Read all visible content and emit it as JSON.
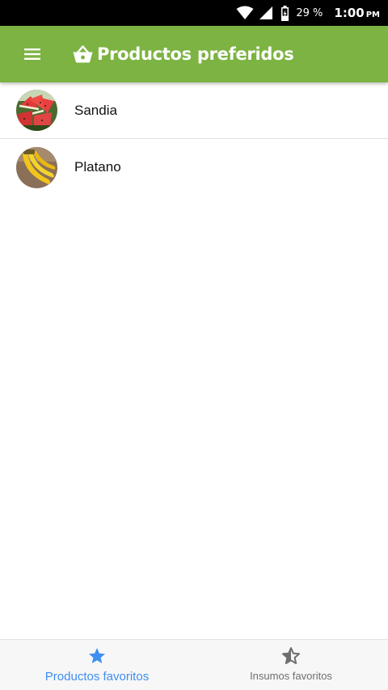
{
  "status_bar": {
    "battery_percent": "29 %",
    "time": "1:00",
    "ampm": "PM",
    "icons": [
      "wifi-icon",
      "cell-signal-icon",
      "battery-icon"
    ]
  },
  "app_bar": {
    "title": "Productos preferidos",
    "menu_icon": "hamburger-menu-icon",
    "title_icon": "shopping-basket-icon",
    "color": "#7cb342"
  },
  "products": [
    {
      "name": "Sandia",
      "image": "watermelon-image"
    },
    {
      "name": "Platano",
      "image": "banana-image"
    }
  ],
  "bottom_nav": {
    "tabs": [
      {
        "label": "Productos favoritos",
        "icon": "star-icon",
        "active": true
      },
      {
        "label": "Insumos favoritos",
        "icon": "half-star-icon",
        "active": false
      }
    ],
    "active_color": "#3f8ef2"
  }
}
